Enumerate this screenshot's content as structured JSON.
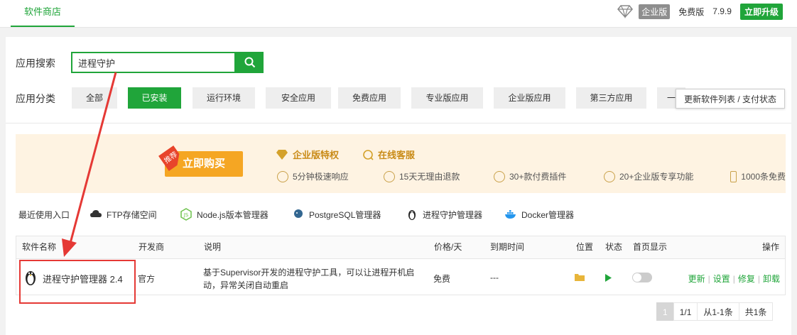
{
  "topbar": {
    "tab_label": "软件商店",
    "edition_badge": "企业版",
    "free_label": "免费版",
    "version": "7.9.9",
    "upgrade_label": "立即升级"
  },
  "search": {
    "label": "应用搜索",
    "value": "进程守护"
  },
  "categories": {
    "label": "应用分类",
    "items": [
      "全部",
      "已安装",
      "运行环境",
      "安全应用",
      "免费应用",
      "专业版应用",
      "企业版应用",
      "第三方应用",
      "一"
    ],
    "active": "已安装",
    "refresh_label": "更新软件列表 / 支付状态"
  },
  "banner": {
    "recommend_tag": "推荐",
    "buy_label": "立即购买",
    "title_enterprise": "企业版特权",
    "title_service": "在线客服",
    "features": [
      "5分钟极速响应",
      "15天无理由退款",
      "30+款付费插件",
      "20+企业版专享功能",
      "1000条免费"
    ]
  },
  "recent": {
    "label": "最近使用入口",
    "items": [
      "FTP存储空间",
      "Node.js版本管理器",
      "PostgreSQL管理器",
      "进程守护管理器",
      "Docker管理器"
    ]
  },
  "table": {
    "headers": {
      "name": "软件名称",
      "vendor": "开发商",
      "desc": "说明",
      "price": "价格/天",
      "expire": "到期时间",
      "location": "位置",
      "status": "状态",
      "home": "首页显示",
      "ops": "操作"
    },
    "rows": [
      {
        "name": "进程守护管理器 2.4",
        "vendor": "官方",
        "desc_line1": "基于Supervisor开发的进程守护工具，可以让进程开机启",
        "desc_line2": "动，异常关闭自动重启",
        "price": "免费",
        "expire": "---",
        "ops": [
          "更新",
          "设置",
          "修复",
          "卸载"
        ]
      }
    ]
  },
  "pager": {
    "current": "1",
    "total_pages": "1/1",
    "range": "从1-1条",
    "count": "共1条"
  },
  "colors": {
    "accent": "#20a53a",
    "annotation": "#e53935",
    "banner_bg": "#fef3e2",
    "buy_button": "#f5a623"
  }
}
